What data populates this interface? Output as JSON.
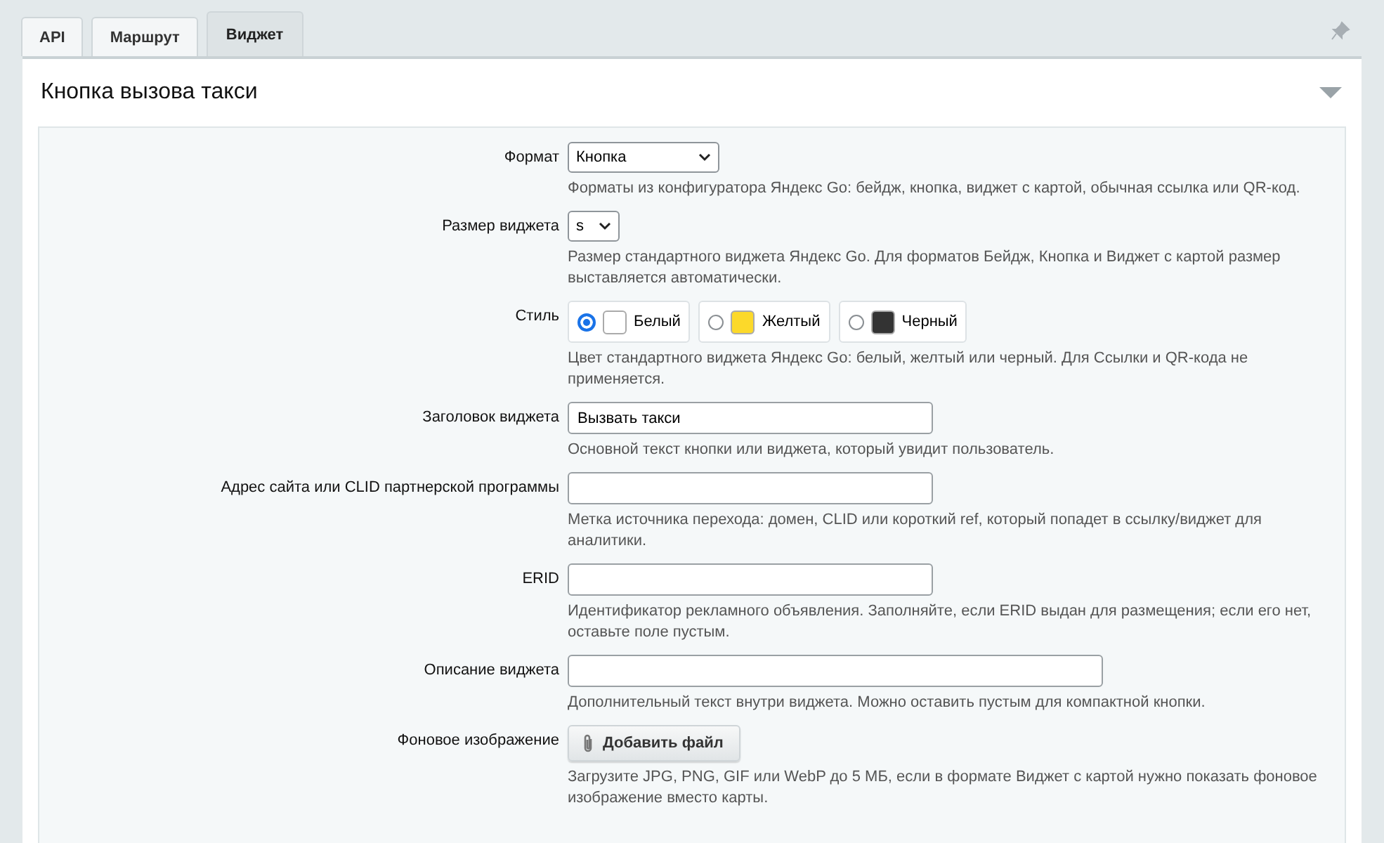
{
  "tabs": [
    {
      "label": "API",
      "selected": false
    },
    {
      "label": "Маршрут",
      "selected": false
    },
    {
      "label": "Виджет",
      "selected": true
    }
  ],
  "section": {
    "title": "Кнопка вызова такси",
    "expanded": true
  },
  "fields": [
    {
      "kind": "select",
      "label": "Формат",
      "value": "Кнопка",
      "hint": "Форматы из конфигуратора Яндекс Go: бейдж, кнопка, виджет с картой, обычная ссылка или QR-код."
    },
    {
      "kind": "select",
      "label": "Размер виджета",
      "value": "s",
      "hint": "Размер стандартного виджета Яндекс Go. Для форматов Бейдж, Кнопка и Виджет с картой размер выставляется автоматически."
    },
    {
      "kind": "radio",
      "label": "Стиль",
      "options": [
        {
          "label": "Белый",
          "color": "#ffffff",
          "selected": true
        },
        {
          "label": "Желтый",
          "color": "#fcd92a",
          "selected": false
        },
        {
          "label": "Черный",
          "color": "#333333",
          "selected": false
        }
      ],
      "hint": "Цвет стандартного виджета Яндекс Go: белый, желтый или черный. Для Ссылки и QR-кода не применяется."
    },
    {
      "kind": "text",
      "label": "Заголовок виджета",
      "value": "Вызвать такси",
      "hint": "Основной текст кнопки или виджета, который увидит пользователь."
    },
    {
      "kind": "text",
      "label": "Адрес сайта или CLID партнерской программы",
      "hint": "Метка источника перехода: домен, CLID или короткий ref, который попадет в ссылку/виджет для аналитики."
    },
    {
      "kind": "text",
      "label": "ERID",
      "hint": "Идентификатор рекламного объявления. Заполняйте, если ERID выдан для размещения; если его нет, оставьте поле пустым."
    },
    {
      "kind": "text",
      "label": "Описание виджета",
      "hint": "Дополнительный текст внутри виджета. Можно оставить пустым для компактной кнопки."
    },
    {
      "kind": "file",
      "label": "Фоновое изображение",
      "button": "Добавить файл",
      "hint": "Загрузите JPG, PNG, GIF или WebP до 5 МБ, если в формате Виджет с картой нужно показать фоновое изображение вместо карты."
    }
  ]
}
